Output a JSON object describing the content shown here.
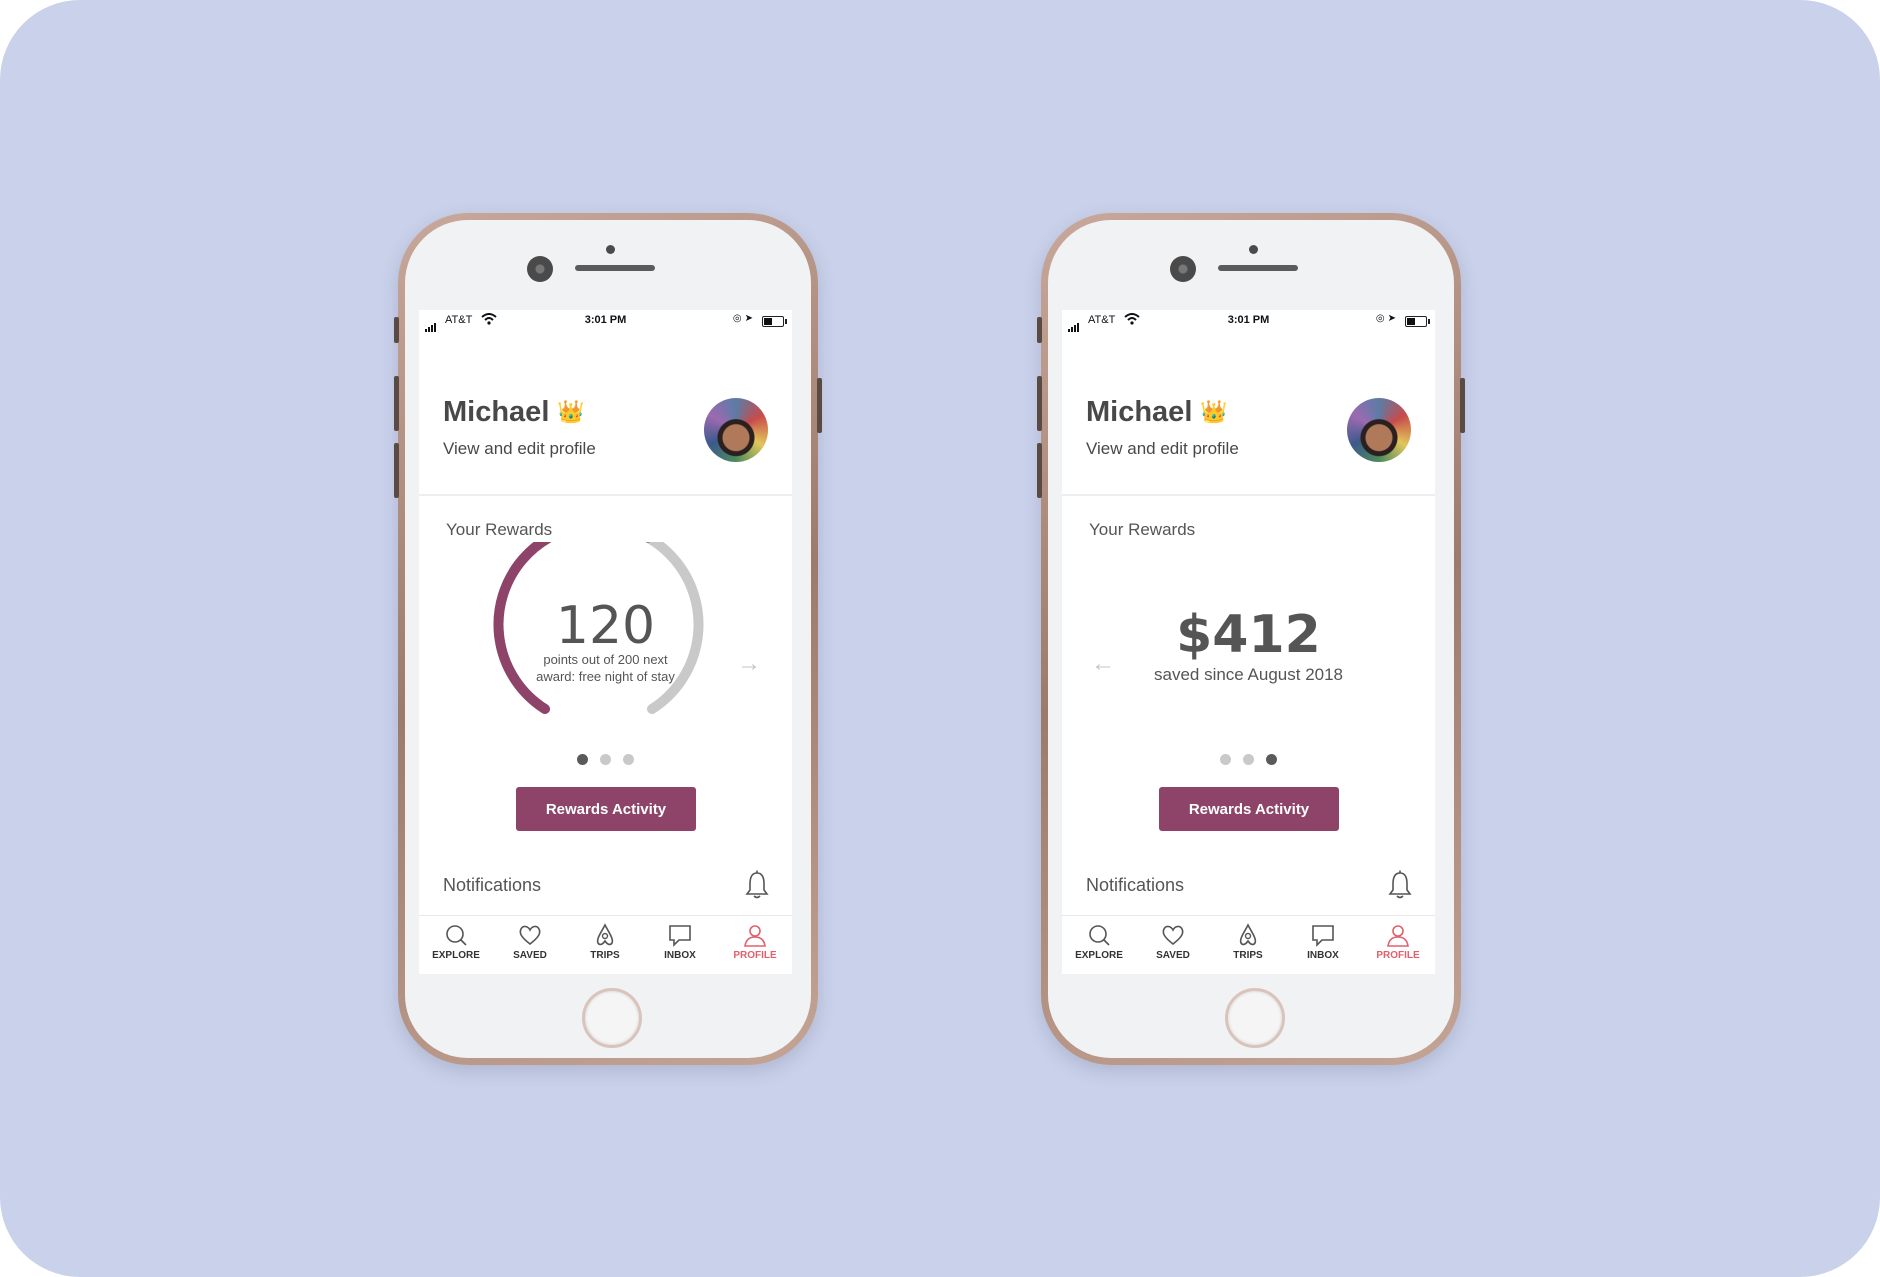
{
  "status_bar": {
    "carrier": "AT&T",
    "time": "3:01 PM"
  },
  "profile": {
    "name": "Michael",
    "crown_icon": "👑",
    "subtitle": "View and edit profile"
  },
  "rewards": {
    "title": "Your Rewards",
    "points_value": "120",
    "points_progress": 0.6,
    "points_text": "points out of 200 next award: free night of stay",
    "savings_value": "$412",
    "savings_text": "saved since August 2018",
    "button_label": "Rewards Activity",
    "arrow_right": "→",
    "arrow_left": "←"
  },
  "notifications": {
    "label": "Notifications"
  },
  "tabs": [
    {
      "label": "EXPLORE",
      "icon": "search-icon"
    },
    {
      "label": "SAVED",
      "icon": "heart-icon"
    },
    {
      "label": "TRIPS",
      "icon": "airbnb-logo-icon"
    },
    {
      "label": "INBOX",
      "icon": "message-icon"
    },
    {
      "label": "PROFILE",
      "icon": "user-icon"
    }
  ],
  "colors": {
    "accent": "#8d4468",
    "active_tab": "#e0616b",
    "background": "#c9d1eb"
  }
}
